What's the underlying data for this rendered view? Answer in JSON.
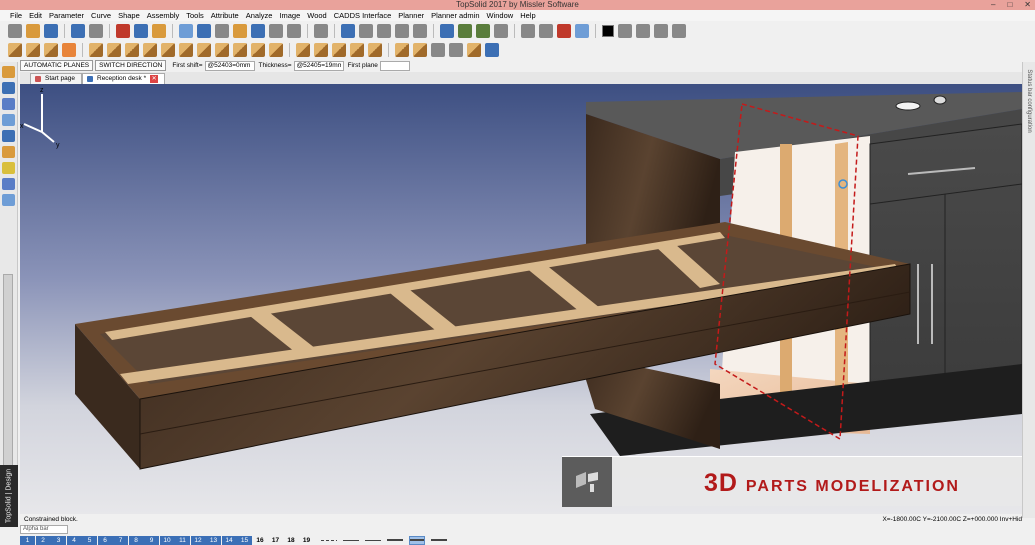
{
  "window": {
    "title": "TopSolid 2017 by Missler Software",
    "controls": [
      "–",
      "□",
      "✕"
    ]
  },
  "menu": [
    "File",
    "Edit",
    "Parameter",
    "Curve",
    "Shape",
    "Assembly",
    "Tools",
    "Attribute",
    "Analyze",
    "Image",
    "Wood",
    "CADDS Interface",
    "Planner",
    "Planner admin",
    "Window",
    "Help"
  ],
  "colors": {
    "titlebar": "#e9a29b",
    "accent_blue": "#3b6fb6",
    "banner_red": "#b21a1a",
    "cut_line": "#c41a1a"
  },
  "options": {
    "auto_planes": "AUTOMATIC PLANES",
    "switch_direction": "SWITCH DIRECTION",
    "first_shift_label": "First shift=",
    "first_shift_value": "@52403=0mm",
    "thickness_label": "Thickness=",
    "thickness_value": "@52405=19mm",
    "first_plane_label": "First plane"
  },
  "tabs": [
    {
      "label": "Start page",
      "active": false
    },
    {
      "label": "Reception desk *",
      "active": true
    }
  ],
  "right_strip": "Status bar configuration",
  "side_label": "TopSolid | Design",
  "banner": {
    "big": "3D ",
    "small": "PARTS MODELIZATION"
  },
  "axes": {
    "x": "x",
    "y": "y",
    "z": "z"
  },
  "status": {
    "message": "Constrained block.",
    "coords": "X=-1800.00C Y=-2100.00C Z=+000.000 Inv+Hid"
  },
  "alpha_bar": "Alpha bar",
  "layers": {
    "active": [
      "1",
      "2",
      "3",
      "4",
      "5",
      "6",
      "7",
      "8",
      "9",
      "10",
      "11",
      "12",
      "13",
      "14",
      "15"
    ],
    "plain": [
      "16",
      "17",
      "18",
      "19"
    ]
  }
}
